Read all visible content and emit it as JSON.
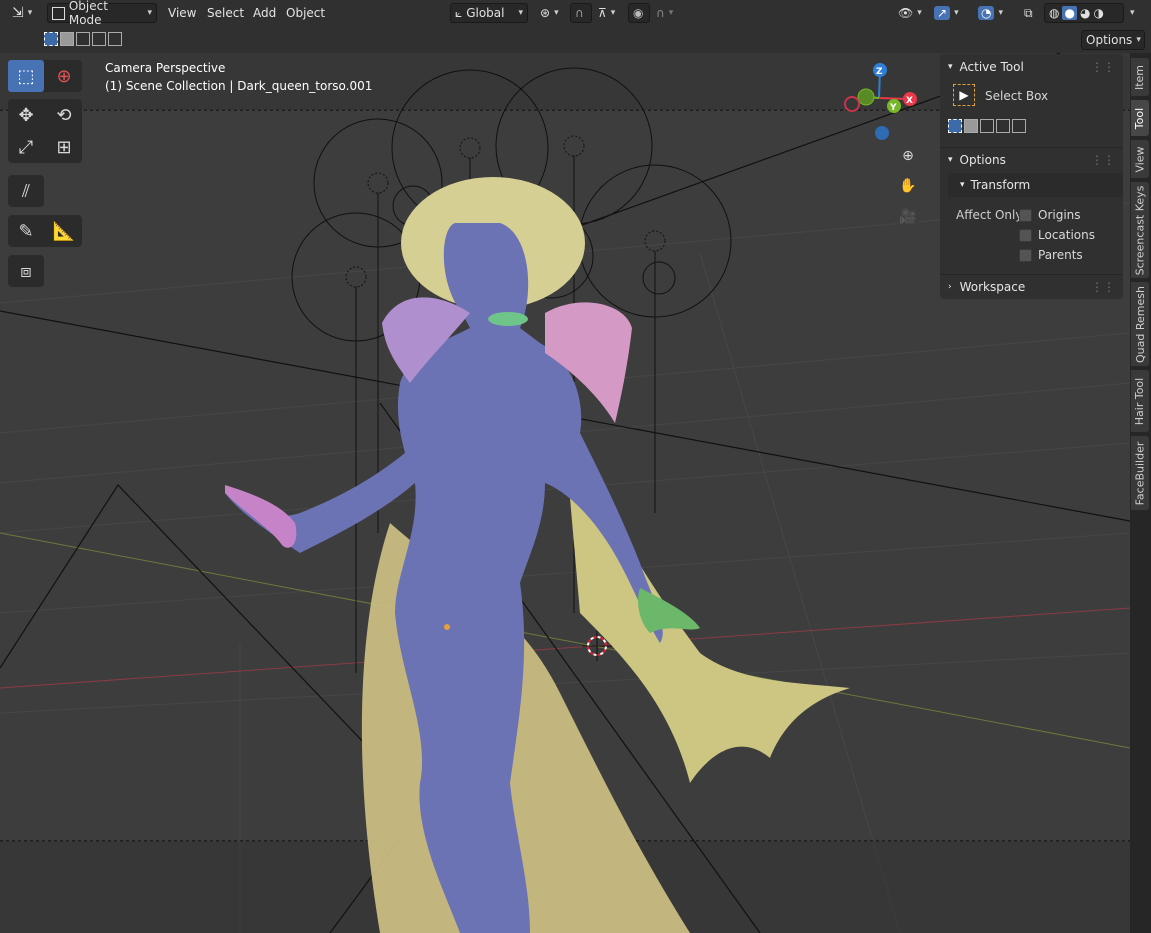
{
  "header": {
    "mode_label": "Object Mode",
    "menus": [
      "View",
      "Select",
      "Add",
      "Object"
    ],
    "transform_orientation": "Global"
  },
  "subheader": {
    "options_label": "Options"
  },
  "viewport": {
    "title": "Camera Perspective",
    "subtitle": "(1) Scene Collection | Dark_queen_torso.001",
    "gizmo_axes": [
      "Z",
      "Y",
      "X"
    ]
  },
  "npanel": {
    "active_tool_header": "Active Tool",
    "active_tool_name": "Select Box",
    "options_header": "Options",
    "transform_header": "Transform",
    "affect_only_label": "Affect Only",
    "affect_options": [
      "Origins",
      "Locations",
      "Parents"
    ],
    "workspace_header": "Workspace"
  },
  "side_tabs": [
    "Item",
    "Tool",
    "View",
    "Screencast Keys",
    "Quad Remesh",
    "Hair Tool",
    "FaceBuilder"
  ],
  "colors": {
    "accent": "#4772b3",
    "axis_x": "#e8384a",
    "axis_y": "#76b82a",
    "axis_z": "#2f7fd6",
    "body": "#6c72b1",
    "cape": "#c8c07c",
    "hair": "#d8d195",
    "armor": "#b58fcd"
  }
}
